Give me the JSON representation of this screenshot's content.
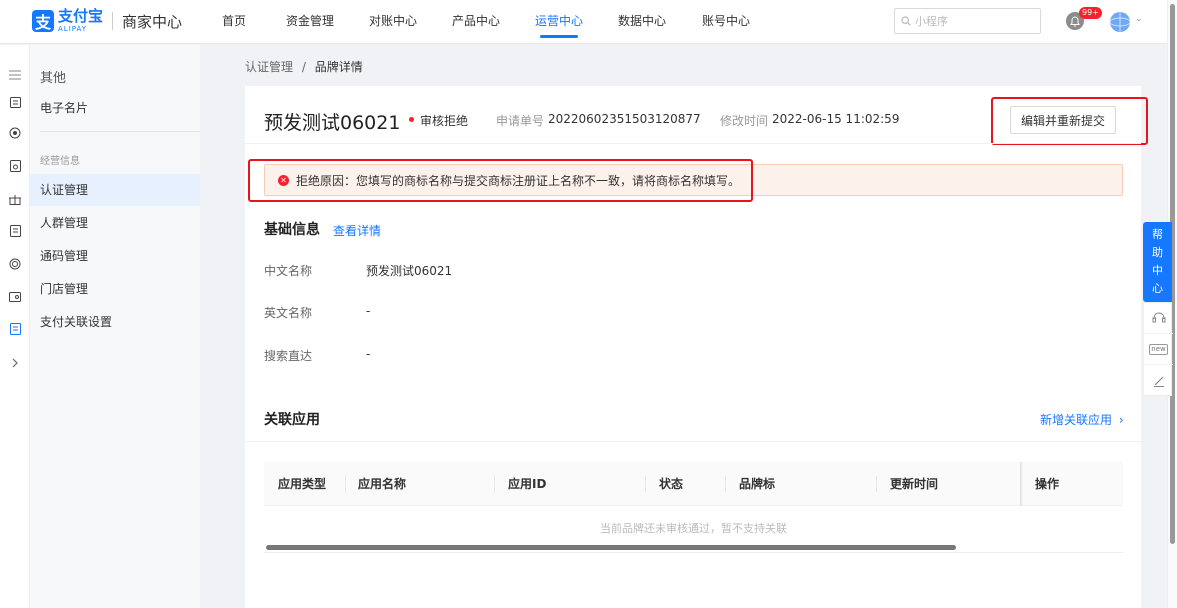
{
  "brand": {
    "logo_char": "支",
    "logo_cn": "支付宝",
    "logo_en": "ALIPAY",
    "title": "商家中心"
  },
  "nav": [
    {
      "label": "首页"
    },
    {
      "label": "资金管理"
    },
    {
      "label": "对账中心"
    },
    {
      "label": "产品中心"
    },
    {
      "label": "运营中心",
      "active": true
    },
    {
      "label": "数据中心"
    },
    {
      "label": "账号中心"
    }
  ],
  "search": {
    "placeholder": "小程序"
  },
  "notifications": {
    "badge": "99+"
  },
  "sidebar": {
    "header": "其他",
    "top_items": [
      {
        "label": "电子名片"
      }
    ],
    "group_title": "经营信息",
    "items": [
      {
        "label": "认证管理",
        "active": true
      },
      {
        "label": "人群管理"
      },
      {
        "label": "通码管理"
      },
      {
        "label": "门店管理"
      },
      {
        "label": "支付关联设置"
      }
    ]
  },
  "breadcrumb": {
    "parent": "认证管理",
    "separator": "/",
    "current": "品牌详情"
  },
  "detail": {
    "title": "预发测试06021",
    "status": "审核拒绝",
    "status_color": "#f5222d",
    "app_no_label": "申请单号",
    "app_no": "20220602351503120877",
    "modified_label": "修改时间",
    "modified": "2022-06-15 11:02:59",
    "edit_button": "编辑并重新提交"
  },
  "alert": {
    "text": "拒绝原因：您填写的商标名称与提交商标注册证上名称不一致，请将商标名称填写。"
  },
  "basic_info": {
    "title": "基础信息",
    "link": "查看详情",
    "rows": [
      {
        "label": "中文名称",
        "value": "预发测试06021"
      },
      {
        "label": "英文名称",
        "value": "-"
      },
      {
        "label": "搜索直达",
        "value": "-"
      }
    ]
  },
  "related_apps": {
    "title": "关联应用",
    "add_link": "新增关联应用",
    "columns": [
      "应用类型",
      "应用名称",
      "应用ID",
      "状态",
      "品牌标",
      "更新时间",
      "操作"
    ],
    "empty_text": "当前品牌还未审核通过，暂不支持关联"
  },
  "help": {
    "chars": [
      "帮",
      "助",
      "中",
      "心"
    ],
    "new_label": "new"
  },
  "colors": {
    "accent": "#1677ff",
    "highlight": "#e8141c",
    "alert_bg": "#fdf1ec"
  }
}
